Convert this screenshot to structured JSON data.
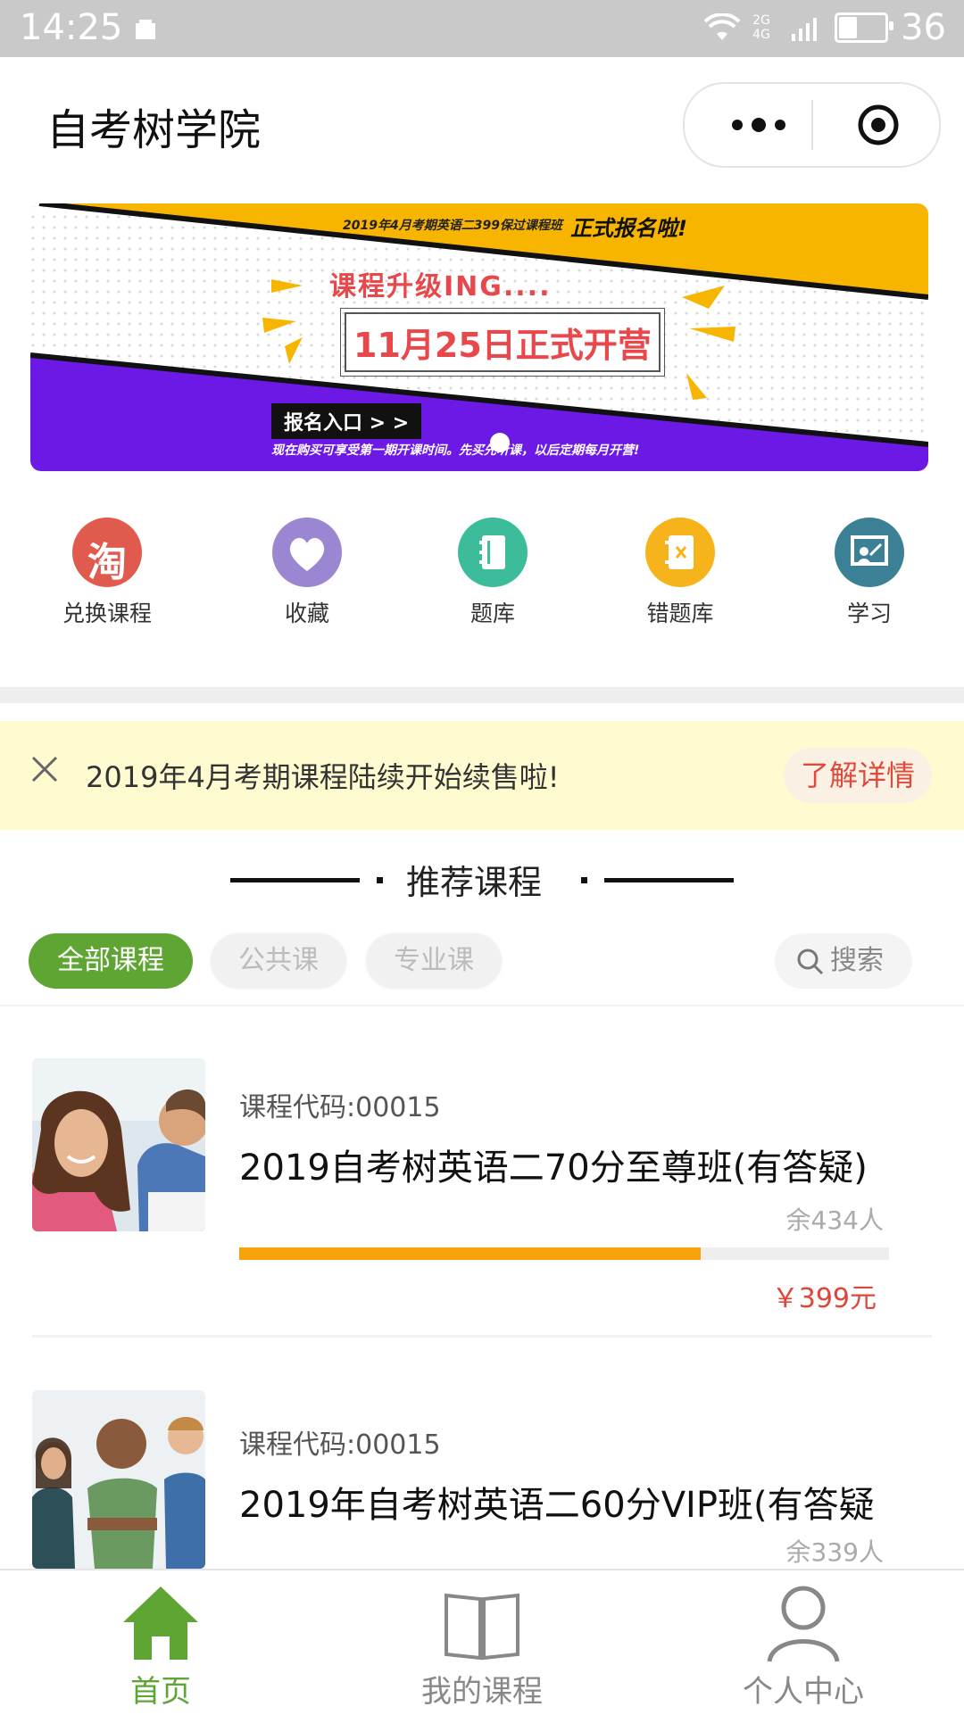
{
  "status_bar": {
    "time": "14:25",
    "network": "2G 4G",
    "battery": "36"
  },
  "header": {
    "title": "自考树学院"
  },
  "banner": {
    "top_small": "2019年4月考期英语二399保过课程班",
    "top_large": "正式报名啦!",
    "upgrade_text": "课程升级ING....",
    "date_text": "11月25日正式开营",
    "entry_text": "报名入口 > >",
    "note_text": "现在购买可享受第一期开课时间。先买先听课，以后定期每月开营!",
    "colors": {
      "yellow": "#f7b500",
      "purple": "#6d19e6",
      "red": "#e8484b"
    }
  },
  "menu": {
    "items": [
      {
        "label": "兑换课程",
        "icon": "taobao-icon",
        "color": "#e05a4e",
        "glyph": "淘"
      },
      {
        "label": "收藏",
        "icon": "heart-icon",
        "color": "#9b86d1"
      },
      {
        "label": "题库",
        "icon": "question-bank-icon",
        "color": "#3dbc9c"
      },
      {
        "label": "错题库",
        "icon": "wrong-question-icon",
        "color": "#f6b31b"
      },
      {
        "label": "学习",
        "icon": "study-board-icon",
        "color": "#3c8096"
      }
    ]
  },
  "notice": {
    "text": "2019年4月考期课程陆续开始续售啦!",
    "button": "了解详情"
  },
  "section": {
    "title": "推荐课程"
  },
  "filters": {
    "tabs": [
      "全部课程",
      "公共课",
      "专业课"
    ],
    "active_index": 0,
    "search_label": "搜索"
  },
  "courses": [
    {
      "code": "课程代码:00015",
      "name": "2019自考树英语二70分至尊班(有答疑)",
      "remaining": "余434人",
      "progress": 0.71,
      "price": "￥399元"
    },
    {
      "code": "课程代码:00015",
      "name": "2019年自考树英语二60分VIP班(有答疑",
      "remaining": "余339人"
    }
  ],
  "tabbar": {
    "items": [
      {
        "label": "首页",
        "icon": "home-icon",
        "active": true
      },
      {
        "label": "我的课程",
        "icon": "book-icon",
        "active": false
      },
      {
        "label": "个人中心",
        "icon": "user-icon",
        "active": false
      }
    ],
    "active_color": "#5fa533",
    "inactive_color": "#888888"
  }
}
